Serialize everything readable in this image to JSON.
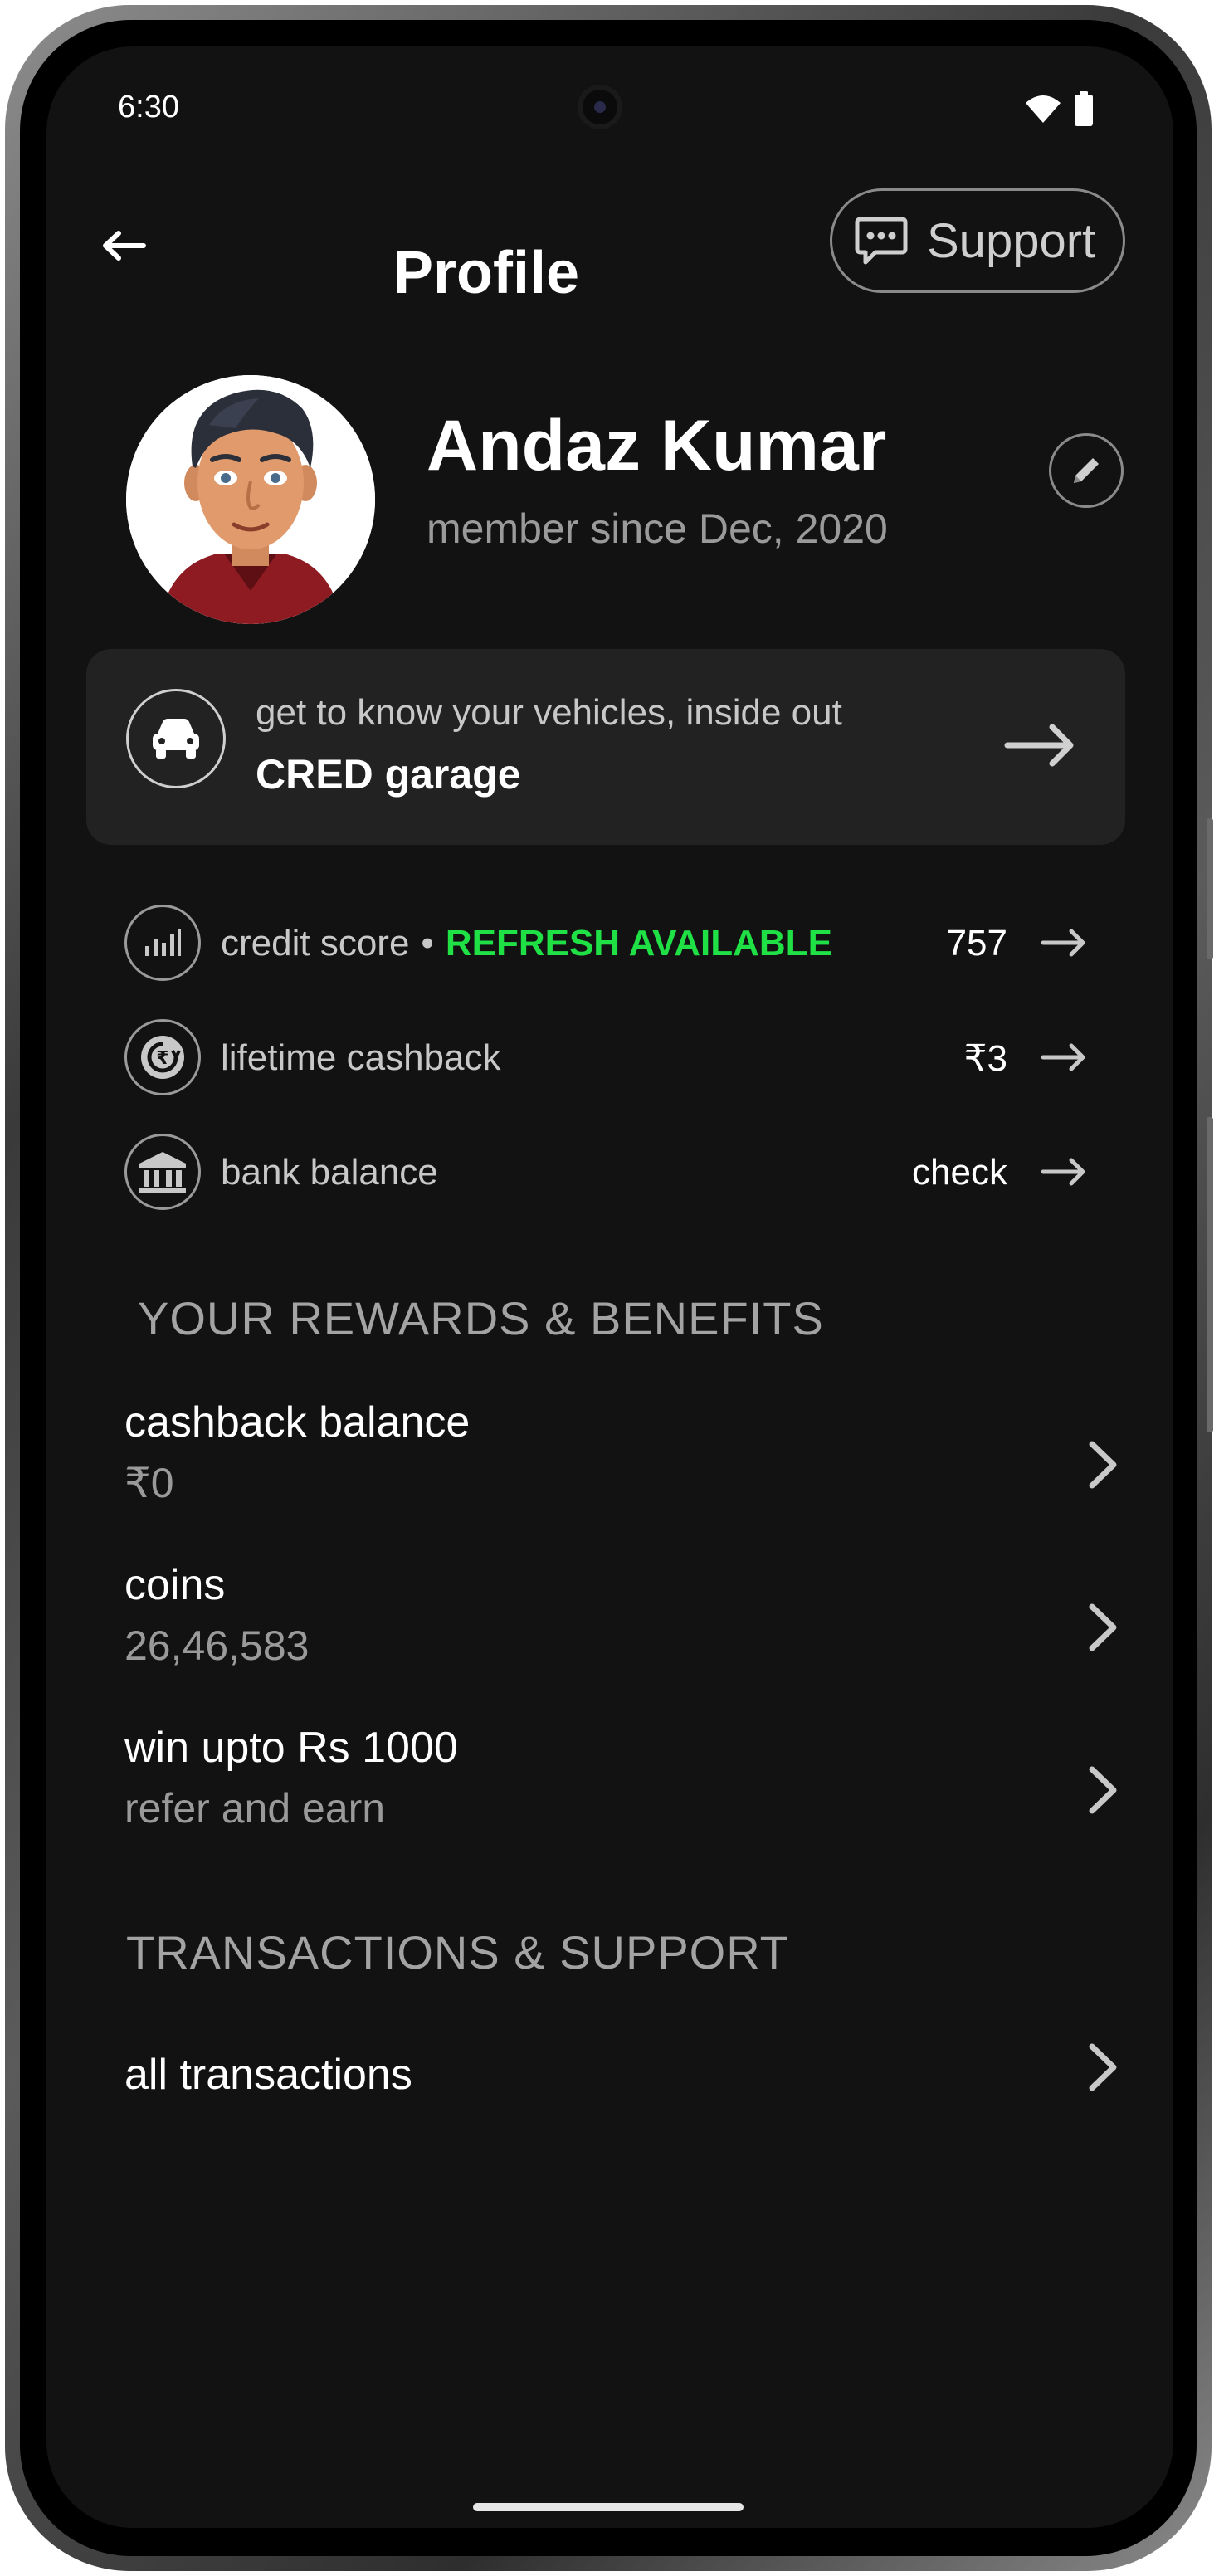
{
  "status_bar": {
    "time": "6:30",
    "wifi_icon": "wifi-icon",
    "battery_icon": "battery-icon"
  },
  "header": {
    "back_icon": "back-arrow-icon",
    "title": "Profile",
    "support_label": "Support",
    "support_icon": "chat-bubble-icon"
  },
  "profile": {
    "name": "Andaz Kumar",
    "member_since": "member since Dec, 2020",
    "edit_icon": "pencil-icon"
  },
  "garage_card": {
    "subtitle": "get to know your vehicles, inside out",
    "title": "CRED garage",
    "icon": "car-icon"
  },
  "stats": [
    {
      "label": "credit score",
      "badge": "REFRESH AVAILABLE",
      "value": "757",
      "icon": "bar-chart-icon"
    },
    {
      "label": "lifetime cashback",
      "badge": "",
      "value": "₹3",
      "icon": "cashback-icon"
    },
    {
      "label": "bank balance",
      "badge": "",
      "value": "check",
      "icon": "bank-icon"
    }
  ],
  "rewards": {
    "section_title": "YOUR REWARDS & BENEFITS",
    "items": [
      {
        "title": "cashback balance",
        "subtitle": "₹0"
      },
      {
        "title": "coins",
        "subtitle": "26,46,583"
      },
      {
        "title": "win upto Rs 1000",
        "subtitle": "refer and earn"
      }
    ]
  },
  "transactions": {
    "section_title": "TRANSACTIONS & SUPPORT",
    "items": [
      {
        "title": "all transactions"
      }
    ]
  },
  "colors": {
    "background": "#121212",
    "card": "#222222",
    "accent_green": "#1fe045",
    "muted_text": "#9a9a9a"
  }
}
